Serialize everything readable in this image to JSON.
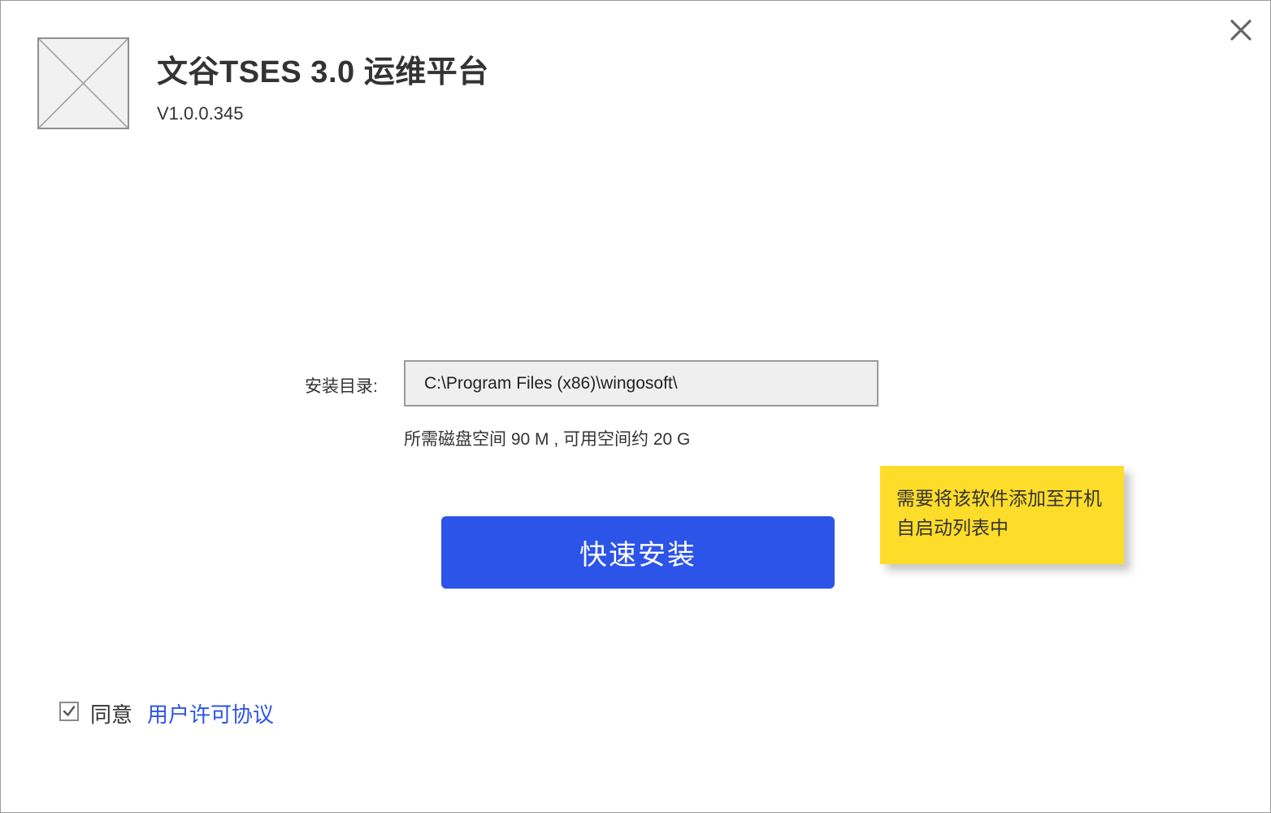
{
  "header": {
    "app_title": "文谷TSES 3.0 运维平台",
    "version": "V1.0.0.345",
    "logo_icon": "image-placeholder-icon",
    "close_icon": "close-icon"
  },
  "install": {
    "dir_label": "安装目录:",
    "dir_value": "C:\\Program Files (x86)\\wingosoft\\",
    "disk_info": "所需磁盘空间 90 M , 可用空间约 20 G",
    "button_label": "快速安装"
  },
  "note": {
    "text": "需要将该软件添加至开机自启动列表中"
  },
  "agreement": {
    "checked": true,
    "agree_label": "同意",
    "link_label": "用户许可协议"
  },
  "colors": {
    "accent": "#2d54e8",
    "note_bg": "#fedc2a",
    "text": "#333333",
    "input_bg": "#efefef"
  }
}
